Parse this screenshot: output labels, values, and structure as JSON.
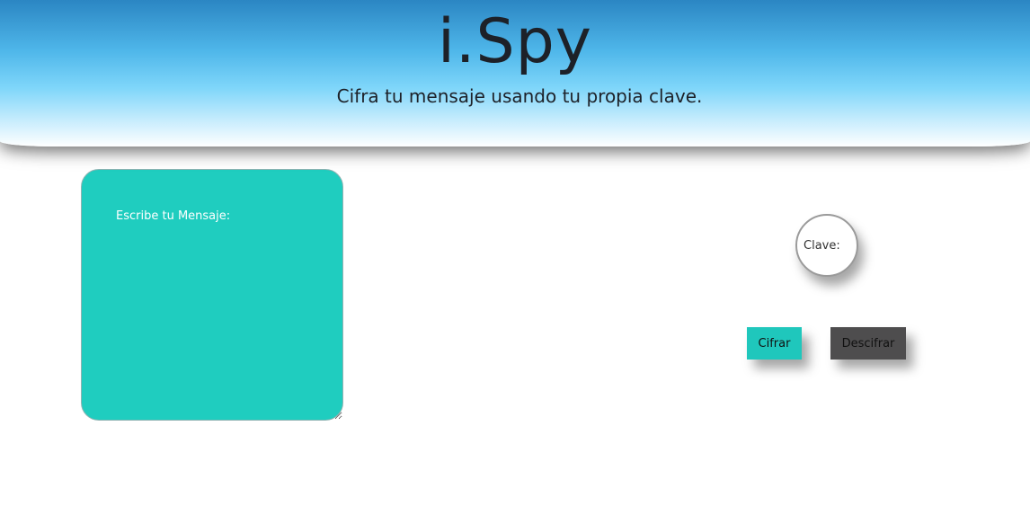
{
  "header": {
    "title": "i.Spy",
    "subtitle": "Cifra tu mensaje usando tu propia clave."
  },
  "message": {
    "placeholder": "Escribe tu Mensaje:",
    "value": ""
  },
  "key": {
    "placeholder": "Clave:",
    "value": ""
  },
  "buttons": {
    "encrypt_label": "Cifrar",
    "decrypt_label": "Descifrar"
  },
  "colors": {
    "accent": "#1fcdbf",
    "header_top": "#2b86c3",
    "decrypt_button": "#4e4d4e",
    "text_dark": "#1d2128"
  }
}
